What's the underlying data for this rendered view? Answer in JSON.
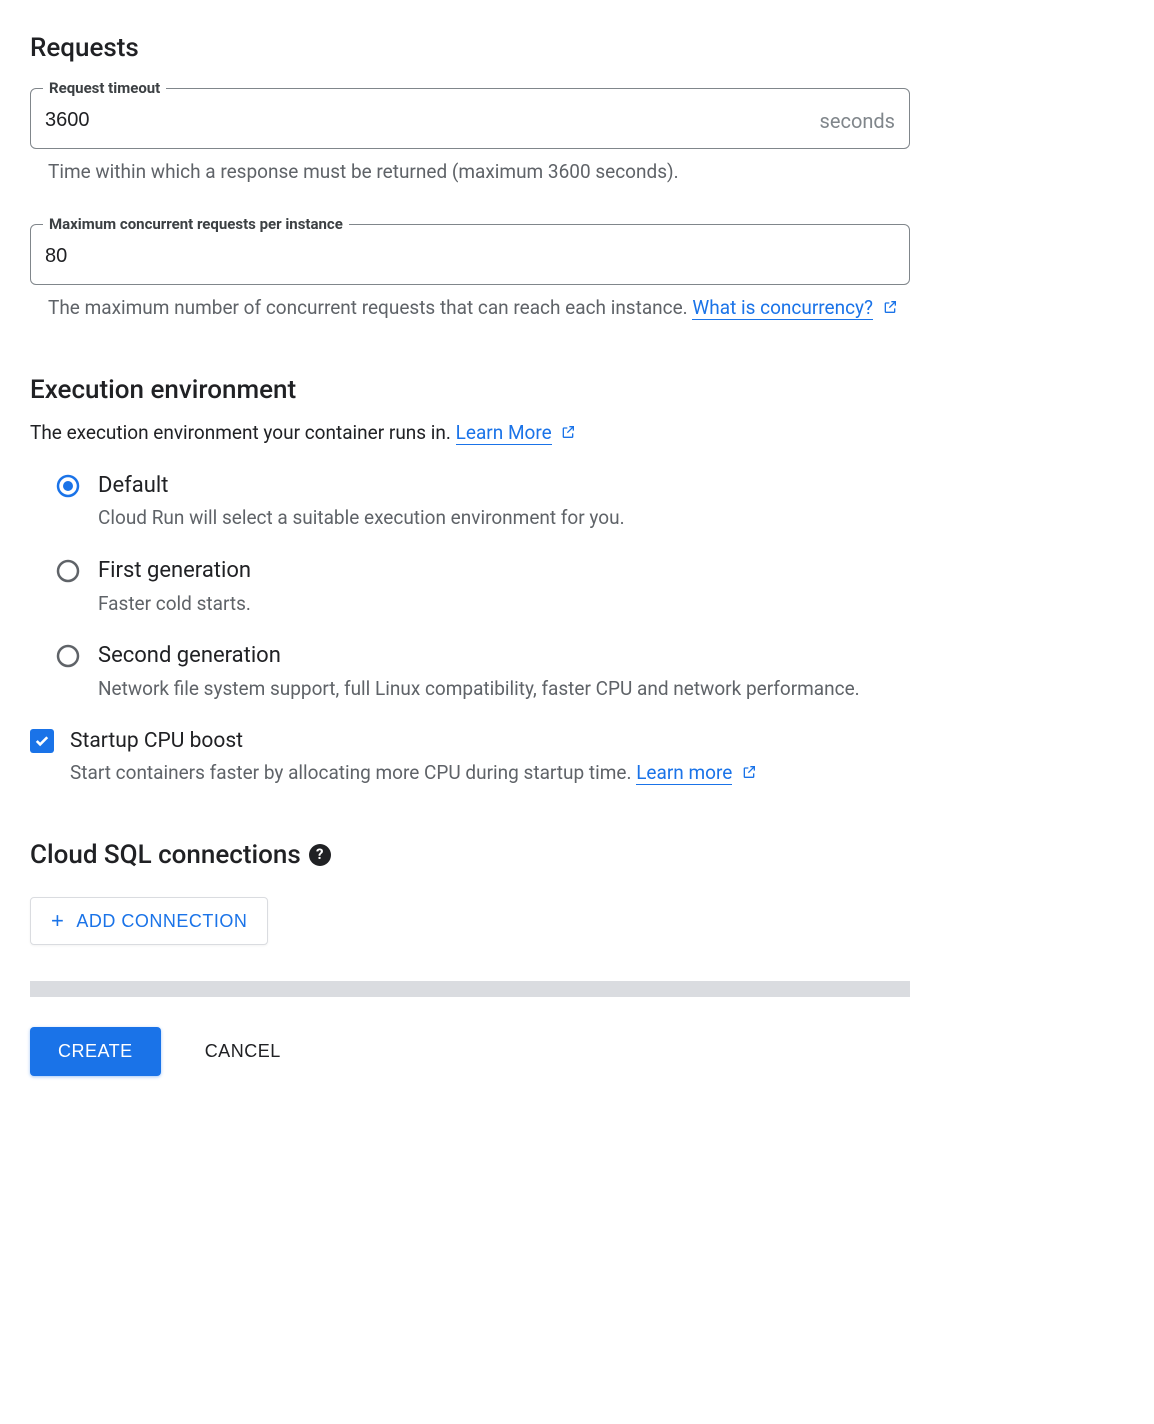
{
  "requests": {
    "title": "Requests",
    "timeout": {
      "label": "Request timeout",
      "value": "3600",
      "suffix": "seconds",
      "helper": "Time within which a response must be returned (maximum 3600 seconds)."
    },
    "concurrency": {
      "label": "Maximum concurrent requests per instance",
      "value": "80",
      "helper_pre": "The maximum number of concurrent requests that can reach each instance. ",
      "link": "What is concurrency?"
    }
  },
  "execution": {
    "title": "Execution environment",
    "desc": "The execution environment your container runs in. ",
    "learn_more": "Learn More",
    "options": [
      {
        "label": "Default",
        "sub": "Cloud Run will select a suitable execution environment for you.",
        "selected": true
      },
      {
        "label": "First generation",
        "sub": "Faster cold starts.",
        "selected": false
      },
      {
        "label": "Second generation",
        "sub": "Network file system support, full Linux compatibility, faster CPU and network performance.",
        "selected": false
      }
    ]
  },
  "startup_boost": {
    "label": "Startup CPU boost",
    "checked": true,
    "desc": "Start containers faster by allocating more CPU during startup time. ",
    "link": "Learn more"
  },
  "cloud_sql": {
    "title": "Cloud SQL connections",
    "add_button": "ADD CONNECTION"
  },
  "footer": {
    "create": "CREATE",
    "cancel": "CANCEL"
  }
}
